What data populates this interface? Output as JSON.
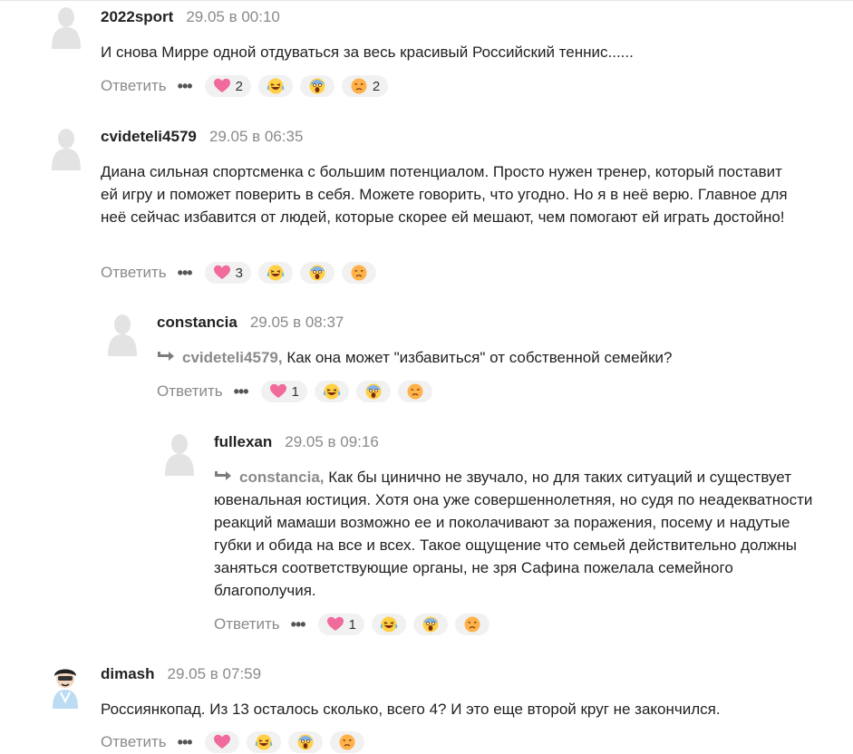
{
  "ui": {
    "reply_label": "Ответить",
    "more_label": "•••"
  },
  "comments": [
    {
      "author": "2022sport",
      "time": "29.05 в 00:10",
      "text": "И снова Мирре одной отдуваться за весь красивый Российский теннис......",
      "reactions": {
        "love": "2",
        "laugh": "",
        "shock": "",
        "sad": "2"
      }
    },
    {
      "author": "cvideteli4579",
      "time": "29.05 в 06:35",
      "text": "Диана сильная спортсменка с большим потенциалом. Просто нужен тренер, который поставит ей игру и поможет поверить в себя. Можете говорить, что угодно. Но я в неё верю. Главное для неё сейчас избавится от людей, которые скорее ей мешают, чем помогают ей играть достойно!",
      "reactions": {
        "love": "3",
        "laugh": "",
        "shock": "",
        "sad": ""
      }
    },
    {
      "author": "constancia",
      "time": "29.05 в 08:37",
      "reply_to": "cvideteli4579,",
      "text": "Как она может \"избавиться\" от собственной семейки?",
      "reactions": {
        "love": "1",
        "laugh": "",
        "shock": "",
        "sad": ""
      }
    },
    {
      "author": "fullexan",
      "time": "29.05 в 09:16",
      "reply_to": "constancia,",
      "text": "Как бы цинично не звучало, но для таких ситуаций и существует ювенальная юстиция. Хотя она уже совершеннолетняя, но судя по неадекватности реакций мамаши возможно ее и поколачивают за поражения, посему и надутые губки и обида на все и всех. Такое ощущение что семьей действительно должны заняться соответствующие органы, не зря Сафина пожелала семейного благополучия.",
      "reactions": {
        "love": "1",
        "laugh": "",
        "shock": "",
        "sad": ""
      }
    },
    {
      "author": "dimash",
      "time": "29.05 в 07:59",
      "text": "Россиянкопад. Из 13 осталось сколько, всего 4? И это еще второй круг не закончился.",
      "reactions": {
        "love": "",
        "laugh": "",
        "shock": "",
        "sad": ""
      }
    }
  ]
}
